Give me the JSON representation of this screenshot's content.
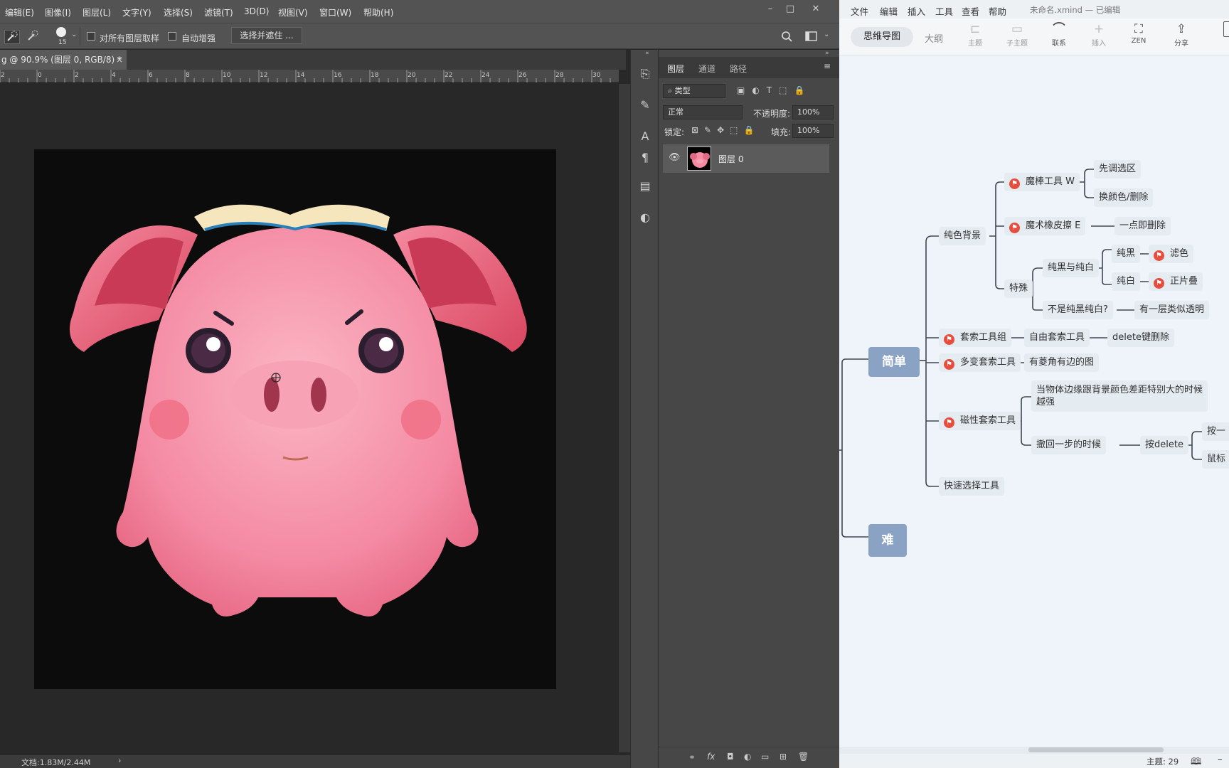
{
  "ps": {
    "menu": [
      "编辑(E)",
      "图像(I)",
      "图层(L)",
      "文字(Y)",
      "选择(S)",
      "滤镜(T)",
      "3D(D)",
      "视图(V)",
      "窗口(W)",
      "帮助(H)"
    ],
    "window_controls": [
      "–",
      "□",
      "✕"
    ],
    "options": {
      "brush_size": "15",
      "sample_all_layers": "对所有图层取样",
      "auto_enhance": "自动增强",
      "select_and_mask": "选择并遮住 ..."
    },
    "doc_tab": "g @ 90.9% (图层 0, RGB/8) *",
    "doc_tab_close": "×",
    "ruler_ticks": [
      "2",
      "0",
      "2",
      "4",
      "6",
      "8",
      "10",
      "12",
      "14",
      "16",
      "18",
      "20",
      "22",
      "24",
      "26",
      "28",
      "30"
    ],
    "status": "文档:1.83M/2.44M",
    "status_arrow": "›",
    "panel": {
      "tabs": [
        "图层",
        "通道",
        "路径"
      ],
      "filter_kind": "类型",
      "blend_mode": "正常",
      "opacity_label": "不透明度:",
      "opacity_value": "100%",
      "lock_label": "锁定:",
      "fill_label": "填充:",
      "fill_value": "100%",
      "layer_name": "图层 0"
    }
  },
  "xmind": {
    "menu": [
      "文件",
      "编辑",
      "插入",
      "工具",
      "查看",
      "帮助"
    ],
    "file_title": "未命名.xmind — 已编辑",
    "view_tabs": {
      "mind": "思维导图",
      "outline": "大纲"
    },
    "toolbar": [
      {
        "label": "主题",
        "glyph": "⊏"
      },
      {
        "label": "子主题",
        "glyph": "▭"
      },
      {
        "label": "联系",
        "glyph": "⌒"
      },
      {
        "label": "插入",
        "glyph": "+"
      },
      {
        "label": "ZEN",
        "glyph": "⛶"
      },
      {
        "label": "分享",
        "glyph": "⇪"
      }
    ],
    "nodes": {
      "easy": "简单",
      "hard": "难",
      "solid_bg": "纯色背景",
      "magic_wand": "魔棒工具  W",
      "select_region": "先调选区",
      "change_color": "换颜色/删除",
      "magic_eraser": "魔术橡皮擦  E",
      "one_click": "一点即删除",
      "special": "特殊",
      "black_white": "纯黑与纯白",
      "pure_black": "纯黑",
      "filter_color": "滤色",
      "pure_white": "纯白",
      "multiply": "正片叠",
      "not_bw": "不是纯黑纯白?",
      "transparent": "有一层类似透明",
      "lasso_group": "套索工具组",
      "free_lasso": "自由套索工具",
      "delete_key": "delete键删除",
      "poly_lasso": "多变套索工具",
      "angular": "有菱角有边的图",
      "magnetic_lasso": "磁性套索工具",
      "edge_line1": "当物体边缘跟背景颜色差距特别大的时候",
      "edge_line2": "越强",
      "undo_step": "撤回一步的时候",
      "press_delete": "按delete",
      "press_one": "按一",
      "mouse": "鼠标",
      "quick_select": "快速选择工具"
    },
    "status": "主题: 29"
  }
}
